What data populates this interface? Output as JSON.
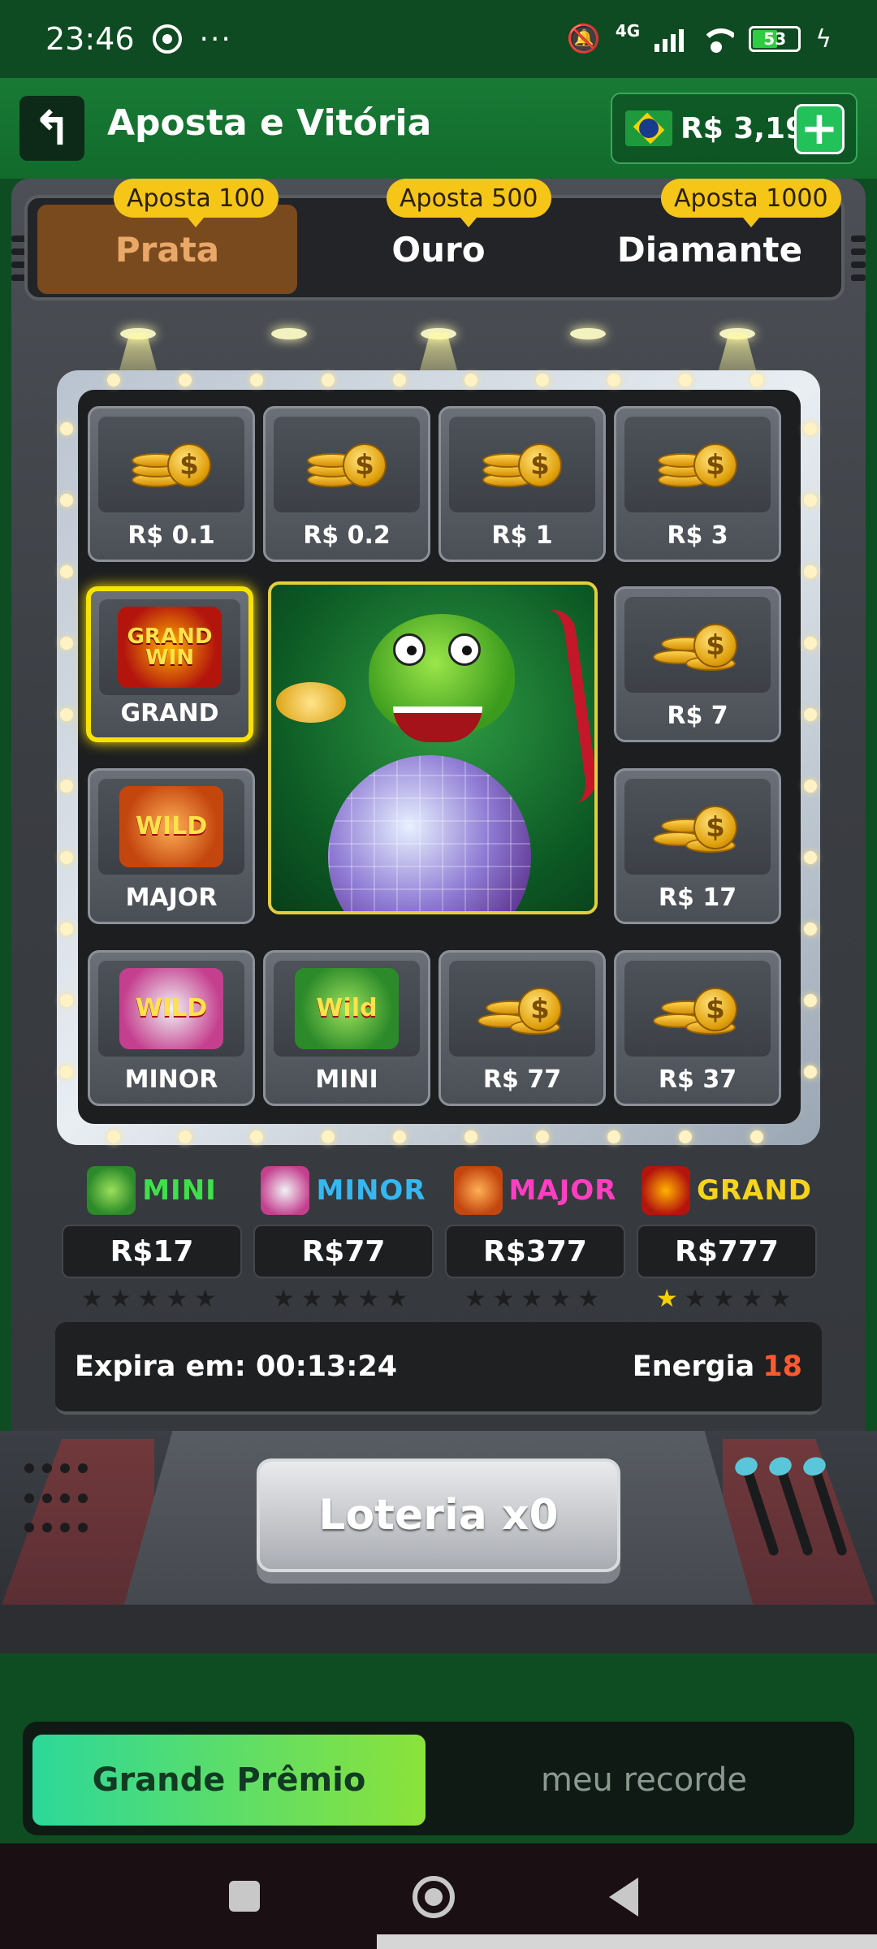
{
  "status": {
    "time": "23:46",
    "battery": "53",
    "network": "4G"
  },
  "header": {
    "title": "Aposta e Vitória",
    "balance": "R$ 3,19",
    "add_symbol": "+",
    "back_symbol": "↰"
  },
  "tabs": [
    {
      "label": "Prata",
      "badge": "Aposta 100",
      "active": true
    },
    {
      "label": "Ouro",
      "badge": "Aposta 500",
      "active": false
    },
    {
      "label": "Diamante",
      "badge": "Aposta 1000",
      "active": false
    }
  ],
  "grid": {
    "cells": [
      {
        "label": "R$ 0.1",
        "icon": "coin-stack-icon"
      },
      {
        "label": "R$ 0.2",
        "icon": "coin-stack-icon"
      },
      {
        "label": "R$ 1",
        "icon": "coin-stack-icon"
      },
      {
        "label": "R$ 3",
        "icon": "coin-stack-icon"
      },
      {
        "label": "GRAND",
        "icon": "grand-win-icon",
        "art_text": "GRAND WIN",
        "selected": true
      },
      {
        "label": "R$ 7",
        "icon": "coin-pile-icon"
      },
      {
        "label": "MAJOR",
        "icon": "tiger-wild-icon",
        "art_text": "WILD"
      },
      {
        "label": "R$ 17",
        "icon": "coin-pile-icon"
      },
      {
        "label": "MINOR",
        "icon": "rabbit-wild-icon",
        "art_text": "WILD"
      },
      {
        "label": "MINI",
        "icon": "dragon-wild-icon",
        "art_text": "Wild"
      },
      {
        "label": "R$ 77",
        "icon": "coin-pile-icon"
      },
      {
        "label": "R$ 37",
        "icon": "coin-pile-icon"
      }
    ],
    "center_image": "dragon-disco-ball"
  },
  "jackpots": [
    {
      "name": "MINI",
      "value": "R$17",
      "color": "#3fe04a",
      "stars_on": 0,
      "stars_total": 5
    },
    {
      "name": "MINOR",
      "value": "R$77",
      "color": "#35b8f0",
      "stars_on": 0,
      "stars_total": 5
    },
    {
      "name": "MAJOR",
      "value": "R$377",
      "color": "#ff3fc0",
      "stars_on": 0,
      "stars_total": 5
    },
    {
      "name": "GRAND",
      "value": "R$777",
      "color": "#f5d51c",
      "stars_on": 1,
      "stars_total": 5
    }
  ],
  "info": {
    "expires_label": "Expira em: 00:13:24",
    "energy_label": "Energia",
    "energy_value": "18"
  },
  "lottery_button": "Loteria x0",
  "bottom_tabs": {
    "active": "Grande Prêmio",
    "inactive": "meu recorde"
  },
  "colors": {
    "accent_green": "#22c15a",
    "selected_border": "#f8e200",
    "energy": "#ff5a2e"
  }
}
